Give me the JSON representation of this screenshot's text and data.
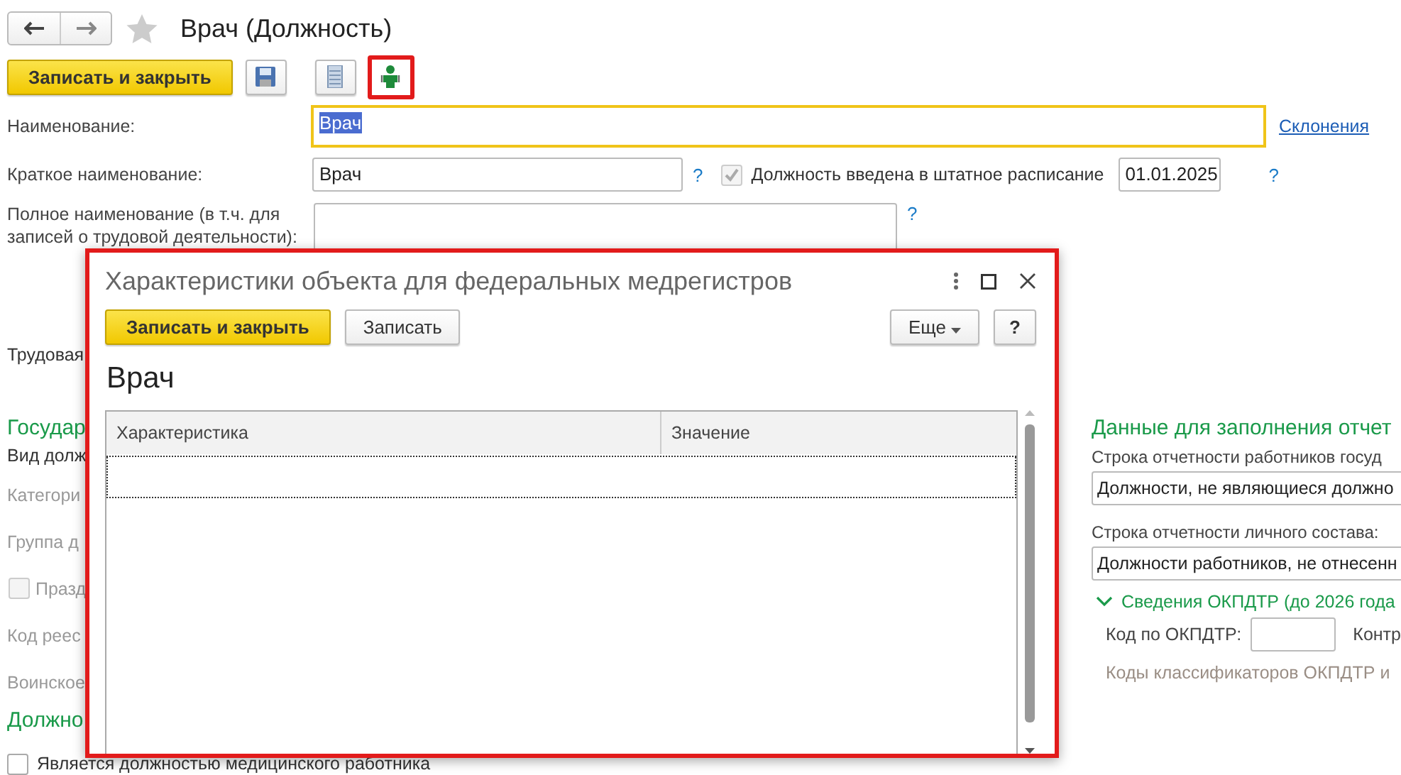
{
  "window": {
    "title": "Врач (Должность)"
  },
  "toolbar": {
    "primary": "Записать и закрыть",
    "tools": [
      {
        "kind": "save",
        "highlighted": false
      },
      {
        "kind": "list",
        "highlighted": false
      },
      {
        "kind": "person",
        "highlighted": true
      }
    ]
  },
  "fields": [
    {
      "kind": "name",
      "label": "Наименование:",
      "value": "Врач",
      "focused": true,
      "link": "Склонения"
    },
    {
      "kind": "short",
      "label": "Краткое наименование:",
      "value": "Врач",
      "help": "?",
      "checkbox": {
        "label": "Должность введена в штатное расписание",
        "checked": true,
        "disabled": true
      },
      "date": "01.01.2025",
      "date_help": "?"
    },
    {
      "kind": "full",
      "label": "Полное наименование (в т.ч. для записей о трудовой деятельности):",
      "help": "?"
    }
  ],
  "labor_label": "Трудовая",
  "left_section": {
    "heading": "Государ",
    "items": [
      {
        "kind": "label",
        "text": "Вид долж",
        "disabled": false
      },
      {
        "kind": "label",
        "text": "Категори",
        "disabled": true
      },
      {
        "kind": "label",
        "text": "Группа д",
        "disabled": true
      },
      {
        "kind": "checkbox",
        "text": "Празд",
        "checked": false,
        "disabled": true
      },
      {
        "kind": "label",
        "text": "Код реес",
        "disabled": true
      },
      {
        "kind": "label",
        "text": "Воинское",
        "disabled": true
      }
    ]
  },
  "medical_section": {
    "heading": "Должно",
    "items": [
      {
        "kind": "checkbox",
        "text": "Является должностью медицинского работника",
        "checked": false,
        "disabled": false
      }
    ]
  },
  "report_section": {
    "heading": "Данные для заполнения отчет",
    "rows": [
      {
        "label": "Строка отчетности работников госуд",
        "value": "Должности, не являющиеся должно"
      },
      {
        "label": "Строка отчетности личного состава:",
        "value": "Должности работников, не отнесенн"
      }
    ],
    "group": {
      "title": "Сведения ОКПДТР (до 2026 года",
      "expanded": true,
      "code_label": "Код по ОКПДТР:",
      "next_label": "Контр",
      "note": "Коды классификаторов ОКПДТР и"
    }
  },
  "dialog": {
    "title": "Характеристики объекта для федеральных медрегистров",
    "highlighted": true,
    "buttons": [
      {
        "label": "Записать и закрыть",
        "kind": "primary"
      },
      {
        "label": "Записать",
        "kind": "normal"
      }
    ],
    "more": "Еще",
    "help": "?",
    "heading": "Врач",
    "table": {
      "columns": [
        "Характеристика",
        "Значение"
      ]
    }
  }
}
